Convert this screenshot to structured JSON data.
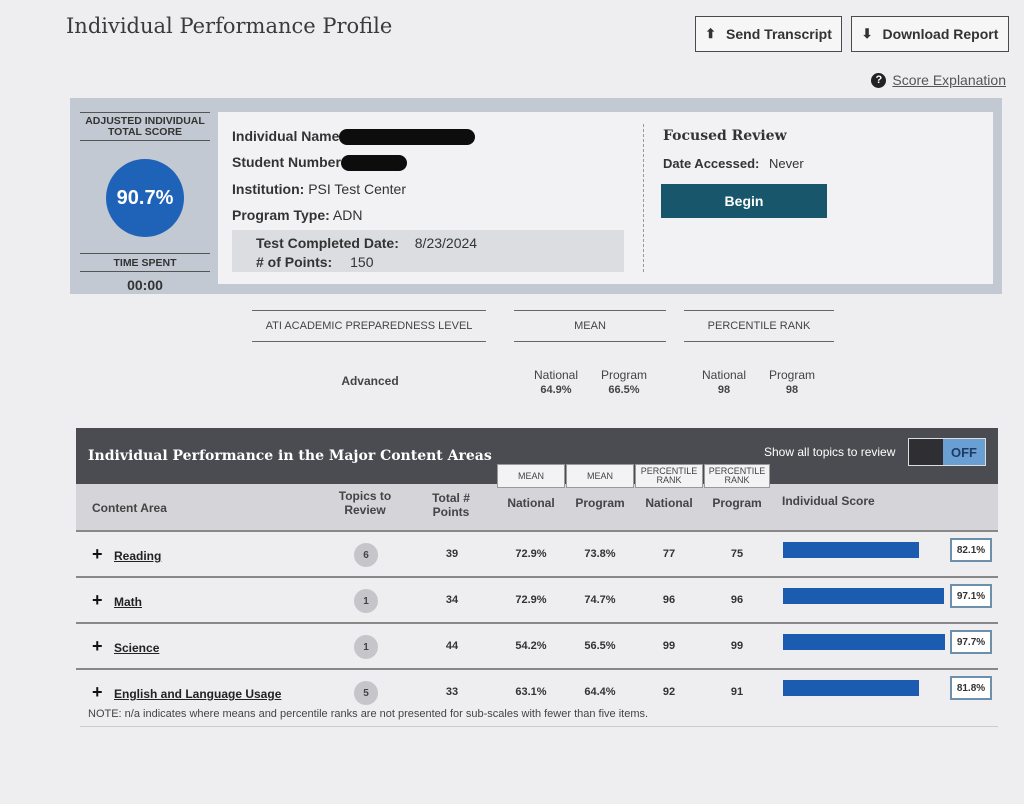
{
  "page": {
    "title": "Individual Performance Profile"
  },
  "toolbar": {
    "send_transcript": "Send Transcript",
    "download_report": "Download Report",
    "score_explanation": "Score Explanation"
  },
  "profile": {
    "adjusted_score_label": "ADJUSTED INDIVIDUAL TOTAL SCORE",
    "adjusted_score": "90.7%",
    "time_spent_label": "TIME SPENT",
    "time_spent": "00:00",
    "individual_name_label": "Individual Name",
    "student_number_label": "Student Number",
    "institution_label": "Institution:",
    "institution": "PSI Test Center",
    "program_type_label": "Program Type:",
    "program_type": "ADN",
    "test_completed_label": "Test Completed Date:",
    "test_completed": "8/23/2024",
    "points_label": "# of Points:",
    "points": "150"
  },
  "focused_review": {
    "title": "Focused Review",
    "date_accessed_label": "Date Accessed:",
    "date_accessed": "Never",
    "begin": "Begin"
  },
  "summary": {
    "preparedness_label": "ATI ACADEMIC PREPAREDNESS LEVEL",
    "preparedness_value": "Advanced",
    "mean_label": "MEAN",
    "mean_national_label": "National",
    "mean_national": "64.9%",
    "mean_program_label": "Program",
    "mean_program": "66.5%",
    "percentile_label": "PERCENTILE RANK",
    "pr_national_label": "National",
    "pr_national": "98",
    "pr_program_label": "Program",
    "pr_program": "98"
  },
  "table": {
    "title": "Individual Performance in the Major Content Areas",
    "toggle_label": "Show all topics to review",
    "toggle_state": "OFF",
    "group_mean": "MEAN",
    "group_percentile": "PERCENTILE RANK",
    "col_content_area": "Content Area",
    "col_topics": "Topics to Review",
    "col_points": "Total # Points",
    "col_national": "National",
    "col_program": "Program",
    "col_individual": "Individual Score",
    "rows": [
      {
        "area": "Reading",
        "topics": "6",
        "points": "39",
        "mean_national": "72.9%",
        "mean_program": "73.8%",
        "pr_national": "77",
        "pr_program": "75",
        "score": "82.1%",
        "score_value": 82.1
      },
      {
        "area": "Math",
        "topics": "1",
        "points": "34",
        "mean_national": "72.9%",
        "mean_program": "74.7%",
        "pr_national": "96",
        "pr_program": "96",
        "score": "97.1%",
        "score_value": 97.1
      },
      {
        "area": "Science",
        "topics": "1",
        "points": "44",
        "mean_national": "54.2%",
        "mean_program": "56.5%",
        "pr_national": "99",
        "pr_program": "99",
        "score": "97.7%",
        "score_value": 97.7
      },
      {
        "area": "English and Language Usage",
        "topics": "5",
        "points": "33",
        "mean_national": "63.1%",
        "mean_program": "64.4%",
        "pr_national": "92",
        "pr_program": "91",
        "score": "81.8%",
        "score_value": 81.8
      }
    ],
    "note": "NOTE: n/a indicates where means and percentile ranks are not presented for sub-scales with fewer than five items."
  },
  "colors": {
    "accent_blue": "#1f63b8",
    "begin_button": "#17566b",
    "header_dark": "#4b4c51"
  }
}
